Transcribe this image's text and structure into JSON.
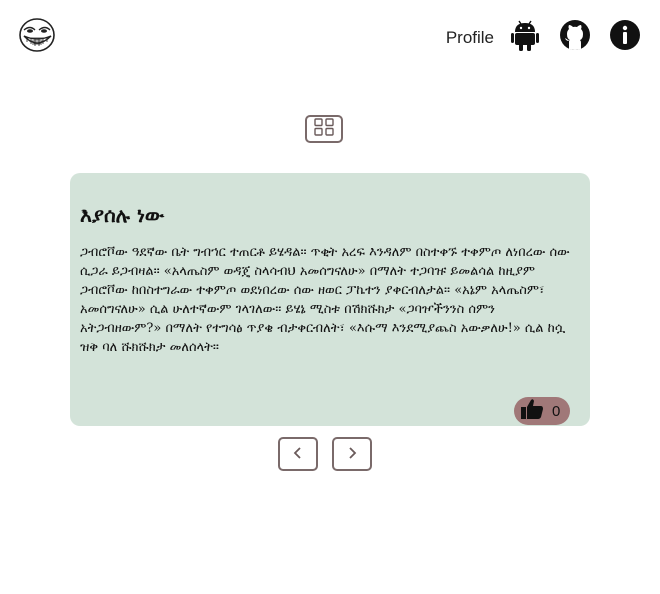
{
  "header": {
    "profile_label": "Profile",
    "icons": [
      "troll-face-logo",
      "android-icon",
      "github-icon",
      "info-icon"
    ]
  },
  "toolbar": {
    "grid_view_icon": "grid-icon"
  },
  "card": {
    "title": "እያሰሉ ነው",
    "body": "ጋብሮቮው ዓደኛው ቤት ግብኀር ተጠርቶ ይሄዳል። ጥቂት አረፍ እንዳለም በስተቀኙ ተቀምጦ ለነበረው ሰው ሲጋራ ይጋብዛል። «አላጤስም ወዳጄ ስላሳብህ አመሰግናለሁ» በማለት ተጋባዡ ይመልሳል ከዚያም ጋብሮቮው ከበስተግራው ተቀምጦ ወደነበረው ሰው ዘወር ፓኬተን ያቀርብለታል። «አኔም አላጤስም፣ አመሰግናለሁ» ሲል ሁለተኛውም ገላገለው፡፡ ይሄኔ ሚስቱ በሽክሹክታ «ጋባዦችንንስ ሰምን አትጋብዘውም?» በማለት የተግሳፅ ጥያቄ ብታቀርብለት፣ «እሱማ እንደሚያጨስ አውቃለሁ!» ሲል ከሷ ዝቅ ባለ ሹክሹክታ መለሰላት።",
    "likes": "0"
  },
  "colors": {
    "card_bg": "#d3e3d9",
    "like_bg": "#a07878",
    "border": "#7a6a6a"
  },
  "pager": {
    "prev_icon": "chevron-left-icon",
    "next_icon": "chevron-right-icon"
  }
}
